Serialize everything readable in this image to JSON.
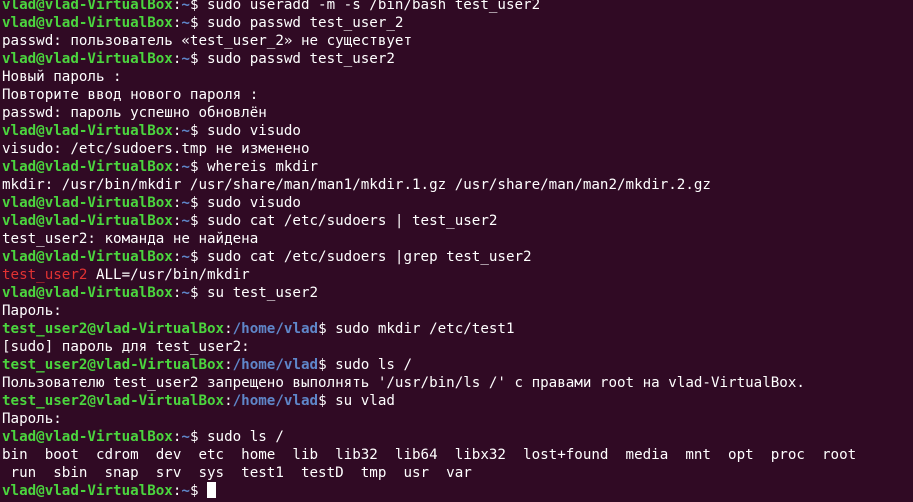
{
  "prompt_user": "vlad@vlad-VirtualBox",
  "prompt_user2": "test_user2@vlad-VirtualBox",
  "path_home": "~",
  "path_vlad": "/home/vlad",
  "lines": [
    {
      "kind": "prompt",
      "who": "vlad",
      "text": "$ sudo useradd -m -s /bin/bash test_user2"
    },
    {
      "kind": "prompt",
      "who": "vlad",
      "text": "$ sudo passwd test_user_2"
    },
    {
      "kind": "out",
      "text": "passwd: пользователь «test_user_2» не существует"
    },
    {
      "kind": "prompt",
      "who": "vlad",
      "text": "$ sudo passwd test_user2"
    },
    {
      "kind": "out",
      "text": "Новый пароль :"
    },
    {
      "kind": "out",
      "text": "Повторите ввод нового пароля :"
    },
    {
      "kind": "out",
      "text": "passwd: пароль успешно обновлён"
    },
    {
      "kind": "prompt",
      "who": "vlad",
      "text": "$ sudo visudo"
    },
    {
      "kind": "out",
      "text": "visudo: /etc/sudoers.tmp не изменено"
    },
    {
      "kind": "prompt",
      "who": "vlad",
      "text": "$ whereis mkdir"
    },
    {
      "kind": "out",
      "text": "mkdir: /usr/bin/mkdir /usr/share/man/man1/mkdir.1.gz /usr/share/man/man2/mkdir.2.gz"
    },
    {
      "kind": "prompt",
      "who": "vlad",
      "text": "$ sudo visudo"
    },
    {
      "kind": "prompt",
      "who": "vlad",
      "text": "$ sudo cat /etc/sudoers | test_user2"
    },
    {
      "kind": "out",
      "text": "test_user2: команда не найдена"
    },
    {
      "kind": "prompt",
      "who": "vlad",
      "text": "$ sudo cat /etc/sudoers |grep test_user2"
    },
    {
      "kind": "grep",
      "match": "test_user2",
      "text": " ALL=/usr/bin/mkdir"
    },
    {
      "kind": "prompt",
      "who": "vlad",
      "text": "$ su test_user2"
    },
    {
      "kind": "out",
      "text": "Пароль:"
    },
    {
      "kind": "prompt",
      "who": "test",
      "text": "$ sudo mkdir /etc/test1"
    },
    {
      "kind": "out",
      "text": "[sudo] пароль для test_user2:"
    },
    {
      "kind": "prompt",
      "who": "test",
      "text": "$ sudo ls /"
    },
    {
      "kind": "out",
      "text": "Пользователю test_user2 запрещено выполнять '/usr/bin/ls /' с правами root на vlad-VirtualBox."
    },
    {
      "kind": "prompt",
      "who": "test",
      "text": "$ su vlad"
    },
    {
      "kind": "out",
      "text": "Пароль:"
    },
    {
      "kind": "prompt",
      "who": "vlad",
      "text": "$ sudo ls /"
    },
    {
      "kind": "out",
      "text": "bin  boot  cdrom  dev  etc  home  lib  lib32  lib64  libx32  lost+found  media  mnt  opt  proc  root"
    },
    {
      "kind": "out",
      "text": " run  sbin  snap  srv  sys  test1  testD  tmp  usr  var"
    },
    {
      "kind": "prompt",
      "who": "vlad",
      "text": "$ ",
      "cursor": true
    }
  ]
}
